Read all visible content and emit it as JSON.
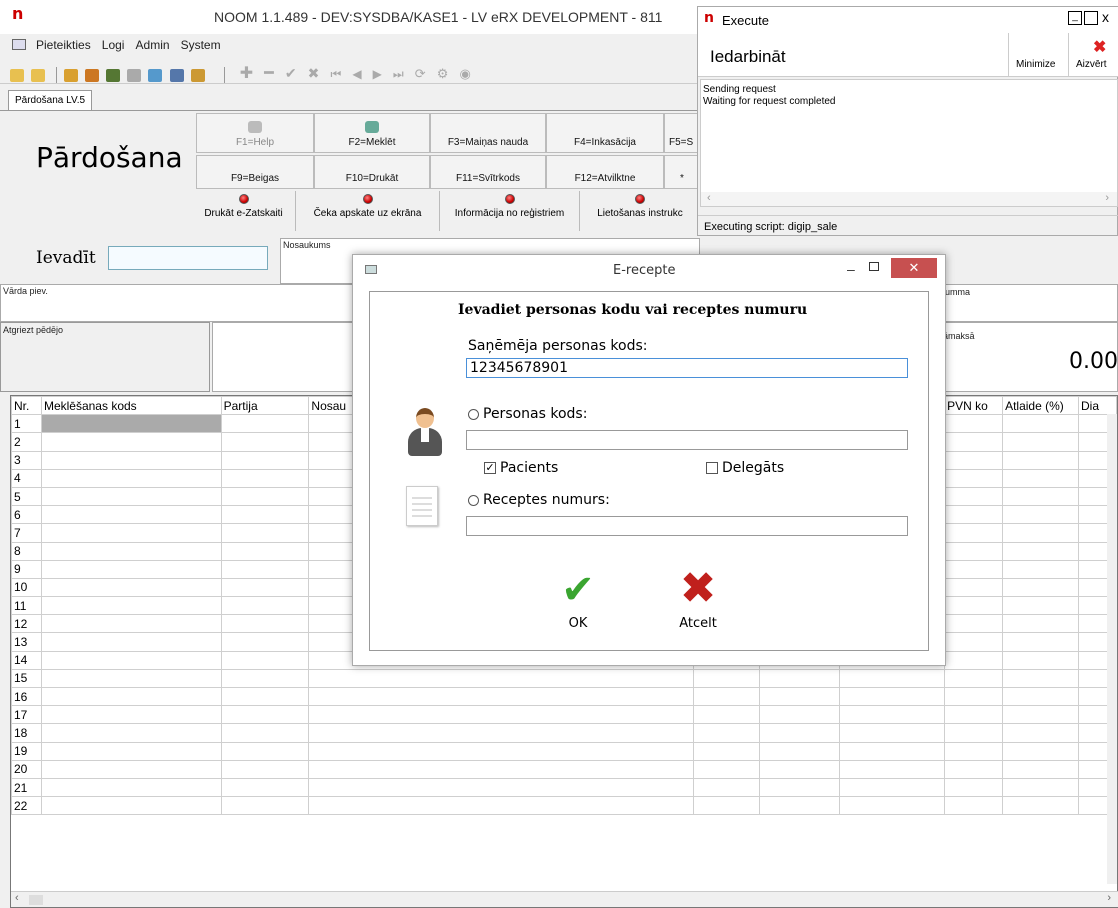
{
  "app": {
    "title": "NOOM 1.1.489 - DEV:SYSDBA/KASE1 - LV eRX DEVELOPMENT - 811",
    "menu": [
      "Pieteikties",
      "Logi",
      "Admin",
      "System"
    ],
    "tab": "Pārdošana LV.5"
  },
  "sale": {
    "title": "Pārdošana",
    "fkeys_row1": [
      "F1=Help",
      "F2=Meklēt",
      "F3=Maiņas nauda",
      "F4=Inkasācija",
      "F5=S"
    ],
    "fkeys_row2": [
      "F9=Beigas",
      "F10=Drukāt",
      "F11=Svītrkods",
      "F12=Atvilktne",
      "*"
    ],
    "red_buttons": [
      "Drukāt e-Zatskaiti",
      "Čeka apskate uz ekrāna",
      "Informācija no reģistriem",
      "Lietošanas instrukc"
    ],
    "enter_label": "Ievadīt",
    "name_label": "Nosaukums",
    "surname_label": "Vārda piev.",
    "return_label": "Atgriezt pēdējo",
    "sum_label": "umma",
    "payable_label": "āmaksā",
    "payable_value": "0.00"
  },
  "grid": {
    "columns": [
      "Nr.",
      "Meklēšanas kods",
      "Partija",
      "Nosau",
      "",
      "",
      "",
      "PVN ko",
      "Atlaide (%)",
      "Dia"
    ],
    "rows": [
      "1",
      "2",
      "3",
      "4",
      "5",
      "6",
      "7",
      "8",
      "9",
      "10",
      "11",
      "12",
      "13",
      "14",
      "15",
      "16",
      "17",
      "18",
      "19",
      "20",
      "21",
      "22"
    ]
  },
  "execute": {
    "window_title": "Execute",
    "heading": "Iedarbināt",
    "minimize": "Minimize",
    "close": "Aizvērt",
    "log_line1": "Sending request",
    "log_line2": "Waiting for request completed",
    "status": "Executing script: digip_sale"
  },
  "dialog": {
    "title": "E-recepte",
    "prompt": "Ievadiet personas kodu vai receptes numuru",
    "recipient_label": "Saņēmēja personas kods:",
    "recipient_value": "12345678901",
    "personal_code_label": "Personas kods:",
    "patient_label": "Pacients",
    "patient_checked": true,
    "delegate_label": "Delegāts",
    "delegate_checked": false,
    "prescription_label": "Receptes numurs:",
    "ok_label": "OK",
    "cancel_label": "Atcelt"
  }
}
